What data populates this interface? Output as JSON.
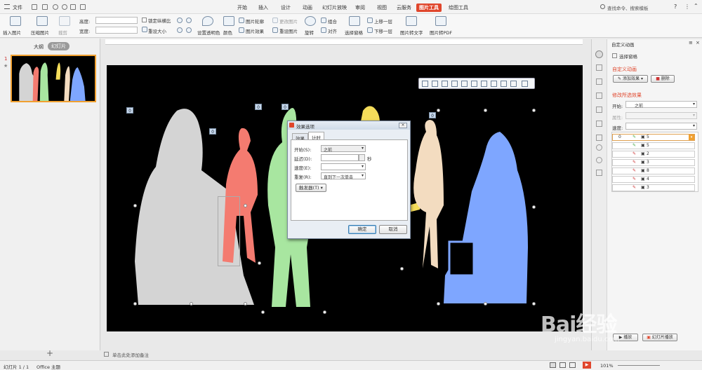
{
  "menu": {
    "file_label": "文件"
  },
  "tabs": [
    "开始",
    "插入",
    "设计",
    "动画",
    "幻灯片放映",
    "审阅",
    "视图",
    "云服务",
    "图片工具",
    "绘图工具"
  ],
  "active_tab": "图片工具",
  "search_placeholder": "查找命令、搜索模板",
  "ribbon": {
    "insert_picture": "插入图片",
    "compress_picture": "压缩图片",
    "crop": "裁剪",
    "height_label": "高度:",
    "width_label": "宽度:",
    "lock_ratio": "锁定纵横比",
    "reset_size": "重设大小",
    "transparent_color": "设置透明色",
    "color": "颜色",
    "picture_outline": "图片轮廓",
    "picture_effect": "图片效果",
    "change_picture": "更改图片",
    "reset_picture": "重设图片",
    "rotate": "旋转",
    "group": "组合",
    "align": "对齐",
    "selection_pane": "选择窗格",
    "bring_forward": "上移一层",
    "send_backward": "下移一层",
    "pic_to_text": "图片转文字",
    "pic_to_pdf": "图片转PDF"
  },
  "left_panel": {
    "tab_outline": "大纲",
    "tab_slides": "幻灯片",
    "slide_number": "1"
  },
  "slide_badges": [
    "0",
    "0",
    "0",
    "0",
    "0"
  ],
  "dialog": {
    "title": "效果选项",
    "tab_effect": "效果",
    "tab_timing": "计时",
    "start_label": "开始(S):",
    "start_value": "之前",
    "delay_label": "延迟(D):",
    "delay_unit": "秒",
    "speed_label": "速度(E):",
    "repeat_label": "重复(R):",
    "repeat_value": "直到下一次单击",
    "trigger_button": "触发器(T)",
    "ok": "确定",
    "cancel": "取消"
  },
  "right_panel": {
    "title": "自定义动画",
    "selection_pane": "选择窗格",
    "section_custom": "自定义动画",
    "add_effect": "添加效果",
    "delete": "删除",
    "section_modify": "修改所选效果",
    "start_label": "开始:",
    "start_value": "之前",
    "property_label": "属性:",
    "speed_label": "速度:",
    "anim_items": [
      {
        "order": "0",
        "label": "5"
      },
      {
        "order": "",
        "label": "5"
      },
      {
        "order": "",
        "label": "2"
      },
      {
        "order": "",
        "label": "3"
      },
      {
        "order": "",
        "label": "8"
      },
      {
        "order": "",
        "label": "4"
      },
      {
        "order": "",
        "label": "3"
      }
    ],
    "play": "播放",
    "slideshow": "幻灯片播放"
  },
  "status": {
    "slide_info": "幻灯片 1 / 1",
    "theme": "Office 主题",
    "notes_placeholder": "单击此处添加备注",
    "zoom": "101%"
  },
  "watermark": {
    "site": "jingyan.baidu.com",
    "brand": "Bai经验"
  },
  "colors": {
    "accent": "#e0462c",
    "figure_gray": "#d4d4d4",
    "figure_red": "#f47b70",
    "figure_green": "#a8e6a0",
    "figure_yellow": "#f4dc5a",
    "figure_beige": "#f3dcc0",
    "figure_blue": "#7ea6ff"
  }
}
